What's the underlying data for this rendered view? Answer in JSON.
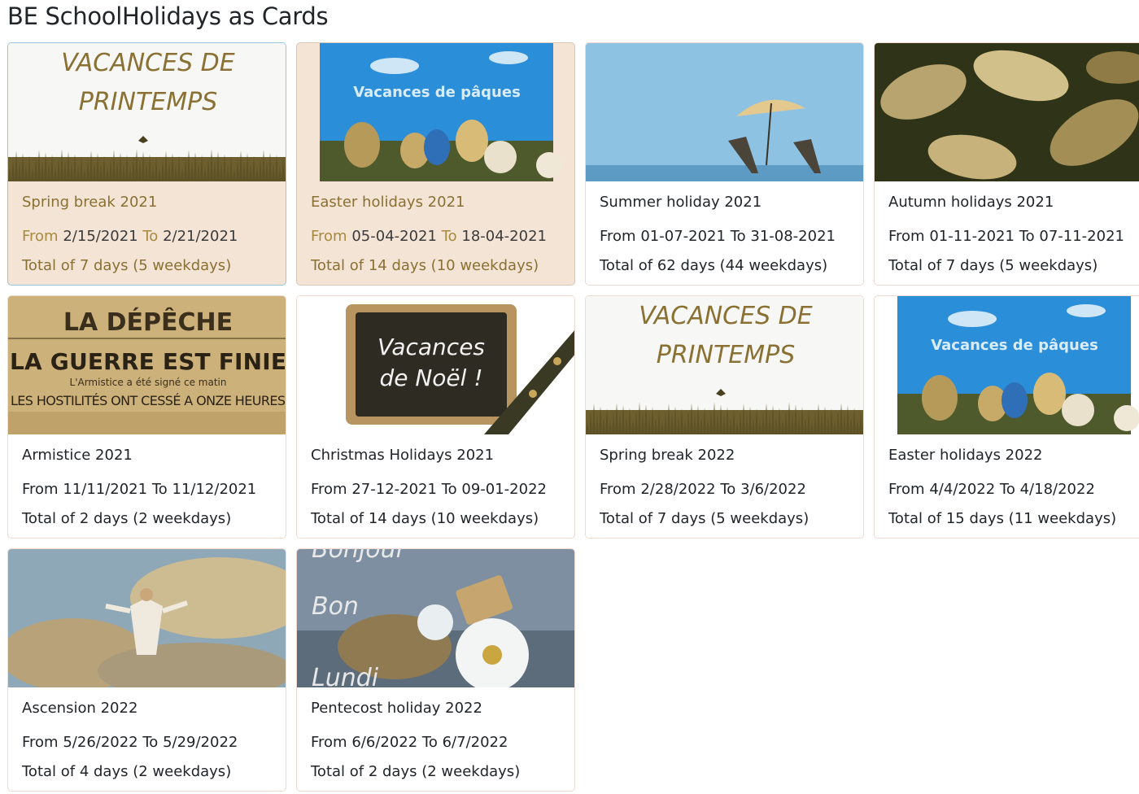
{
  "page": {
    "title": "BE SchoolHolidays as Cards"
  },
  "labels": {
    "from": "From",
    "to": "To"
  },
  "colors": {
    "highlight_bg": "#f3e4d5",
    "highlight_title": "#8a7032",
    "card_border": "#f0d9d0",
    "text": "#212529"
  },
  "cards": [
    {
      "title": "Spring break 2021",
      "from": "2/15/2021",
      "to": "2/21/2021",
      "total": "Total of 7 days (5 weekdays)",
      "image": "spring-grass",
      "image_text": [
        "VACANCES DE",
        "PRINTEMPS"
      ],
      "highlighted": true,
      "selected": true
    },
    {
      "title": "Easter holidays 2021",
      "from": "05-04-2021",
      "to": "18-04-2021",
      "total": "Total of 14 days (10 weekdays)",
      "image": "easter-eggs",
      "image_text": [
        "Vacances de pâques"
      ],
      "highlighted": true
    },
    {
      "title": "Summer holiday 2021",
      "from": "01-07-2021",
      "to": "31-08-2021",
      "total": "Total of 62 days (44 weekdays)",
      "image": "beach-umbrella"
    },
    {
      "title": "Autumn holidays 2021",
      "from": "01-11-2021",
      "to": "07-11-2021",
      "total": "Total of 7 days (5 weekdays)",
      "image": "autumn-leaves"
    },
    {
      "title": "Armistice 2021",
      "from": "11/11/2021",
      "to": "11/12/2021",
      "total": "Total of 2 days (2 weekdays)",
      "image": "newspaper",
      "image_text": [
        "LA DÉPÊCHE",
        "LA GUERRE EST FINIE",
        "L'Armistice a été signé ce matin",
        "LES HOSTILITÉS ONT CESSÉ A ONZE HEURES"
      ]
    },
    {
      "title": "Christmas Holidays 2021",
      "from": "27-12-2021",
      "to": "09-01-2022",
      "total": "Total of 14 days (10 weekdays)",
      "image": "chalkboard",
      "image_text": [
        "Vacances",
        "de Noël !"
      ]
    },
    {
      "title": "Spring break 2022",
      "from": "2/28/2022",
      "to": "3/6/2022",
      "total": "Total of 7 days (5 weekdays)",
      "image": "spring-grass",
      "image_text": [
        "VACANCES DE",
        "PRINTEMPS"
      ]
    },
    {
      "title": "Easter holidays 2022",
      "from": "4/4/2022",
      "to": "4/18/2022",
      "total": "Total of 15 days (11 weekdays)",
      "image": "easter-eggs",
      "image_text": [
        "Vacances de pâques"
      ]
    },
    {
      "title": "Ascension 2022",
      "from": "5/26/2022",
      "to": "5/29/2022",
      "total": "Total of 4 days (2 weekdays)",
      "image": "ascension-clouds"
    },
    {
      "title": "Pentecost holiday 2022",
      "from": "6/6/2022",
      "to": "6/7/2022",
      "total": "Total of 2 days (2 weekdays)",
      "image": "flowers",
      "image_text": [
        "Bonjour",
        "Bon",
        "Lundi"
      ]
    }
  ]
}
